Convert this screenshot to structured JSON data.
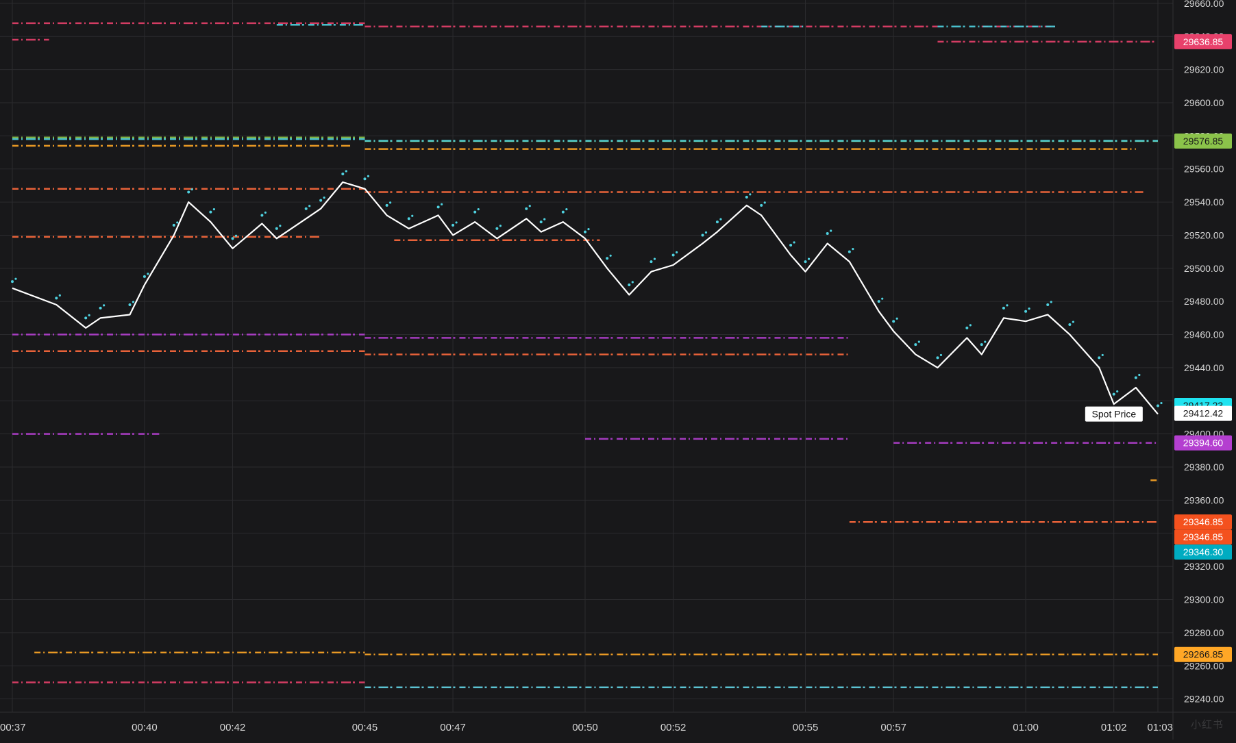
{
  "chart_data": {
    "type": "line",
    "title": "",
    "xlabel": "",
    "ylabel": "",
    "grid": true,
    "x_ticks": [
      "00:37",
      "00:40",
      "00:42",
      "00:45",
      "00:47",
      "00:50",
      "00:52",
      "00:55",
      "00:57",
      "01:00",
      "01:02",
      "01:03"
    ],
    "y_ticks": [
      29240,
      29260,
      29280,
      29300,
      29320,
      29340,
      29360,
      29380,
      29400,
      29420,
      29440,
      29460,
      29480,
      29500,
      29520,
      29540,
      29560,
      29580,
      29600,
      29620,
      29640,
      29660
    ],
    "ylim": [
      29232,
      29662
    ],
    "series": [
      {
        "name": "Spot Price",
        "color": "#ffffff",
        "style": "line",
        "x": [
          "00:37",
          "00:38",
          "00:38:40",
          "00:39",
          "00:39:40",
          "00:40",
          "00:40:40",
          "00:41",
          "00:41:30",
          "00:42",
          "00:42:40",
          "00:43",
          "00:43:40",
          "00:44",
          "00:44:30",
          "00:45",
          "00:45:30",
          "00:46",
          "00:46:40",
          "00:47",
          "00:47:30",
          "00:48",
          "00:48:40",
          "00:49",
          "00:49:30",
          "00:50",
          "00:50:30",
          "00:51",
          "00:51:30",
          "00:52",
          "00:52:40",
          "00:53",
          "00:53:40",
          "00:54",
          "00:54:40",
          "00:55",
          "00:55:30",
          "00:56",
          "00:56:40",
          "00:57",
          "00:57:30",
          "00:58",
          "00:58:40",
          "00:59",
          "00:59:30",
          "01:00",
          "01:00:30",
          "01:01",
          "01:01:40",
          "01:02",
          "01:02:30",
          "01:03"
        ],
        "y": [
          29488,
          29478,
          29464,
          29470,
          29472,
          29490,
          29520,
          29540,
          29528,
          29512,
          29527,
          29518,
          29530,
          29536,
          29552,
          29548,
          29532,
          29524,
          29532,
          29520,
          29528,
          29518,
          29530,
          29522,
          29528,
          29518,
          29500,
          29484,
          29498,
          29502,
          29515,
          29522,
          29538,
          29532,
          29508,
          29498,
          29515,
          29504,
          29474,
          29462,
          29448,
          29440,
          29458,
          29448,
          29470,
          29468,
          29472,
          29460,
          29440,
          29418,
          29428,
          29412
        ]
      },
      {
        "name": "Spot Price (tick)",
        "color": "#4fd2e0",
        "style": "dots",
        "x": [
          "00:37",
          "00:38",
          "00:38:40",
          "00:39",
          "00:39:40",
          "00:40",
          "00:40:40",
          "00:41",
          "00:41:30",
          "00:42",
          "00:42:40",
          "00:43",
          "00:43:40",
          "00:44",
          "00:44:30",
          "00:45",
          "00:45:30",
          "00:46",
          "00:46:40",
          "00:47",
          "00:47:30",
          "00:48",
          "00:48:40",
          "00:49",
          "00:49:30",
          "00:50",
          "00:50:30",
          "00:51",
          "00:51:30",
          "00:52",
          "00:52:40",
          "00:53",
          "00:53:40",
          "00:54",
          "00:54:40",
          "00:55",
          "00:55:30",
          "00:56",
          "00:56:40",
          "00:57",
          "00:57:30",
          "00:58",
          "00:58:40",
          "00:59",
          "00:59:30",
          "01:00",
          "01:00:30",
          "01:01",
          "01:01:40",
          "01:02",
          "01:02:30",
          "01:03"
        ],
        "y": [
          29492,
          29482,
          29470,
          29476,
          29478,
          29495,
          29526,
          29546,
          29534,
          29518,
          29532,
          29524,
          29536,
          29541,
          29557,
          29554,
          29538,
          29530,
          29537,
          29526,
          29534,
          29524,
          29536,
          29528,
          29534,
          29522,
          29506,
          29490,
          29504,
          29508,
          29520,
          29528,
          29543,
          29538,
          29514,
          29504,
          29521,
          29510,
          29480,
          29468,
          29454,
          29446,
          29464,
          29454,
          29476,
          29474,
          29478,
          29466,
          29446,
          29424,
          29434,
          29417
        ]
      }
    ],
    "levels": [
      {
        "color": "#e8416b",
        "segments": [
          [
            29648,
            "00:37",
            "00:45"
          ],
          [
            29646,
            "00:45",
            "00:58"
          ],
          [
            29646,
            "00:59",
            "01:00:40"
          ]
        ]
      },
      {
        "color": "#4fd2e0",
        "segments": [
          [
            29647,
            "00:43",
            "00:45"
          ],
          [
            29646,
            "00:54",
            "00:55"
          ],
          [
            29646,
            "00:58",
            "01:00:40"
          ]
        ]
      },
      {
        "color": "#e8416b",
        "segments": [
          [
            29638,
            "00:37",
            "00:37:50"
          ],
          [
            29636.85,
            "00:58",
            "01:03"
          ]
        ]
      },
      {
        "color": "#8bc34a",
        "segments": [
          [
            29579,
            "00:37",
            "00:45"
          ],
          [
            29576.85,
            "00:45",
            "01:03"
          ]
        ]
      },
      {
        "color": "#4fd2e0",
        "segments": [
          [
            29578,
            "00:37",
            "00:45"
          ],
          [
            29577,
            "00:45",
            "01:03"
          ]
        ]
      },
      {
        "color": "#ffa726",
        "segments": [
          [
            29574,
            "00:37",
            "00:44:40"
          ],
          [
            29572,
            "00:45",
            "01:02:30"
          ]
        ]
      },
      {
        "color": "#ff6b3d",
        "segments": [
          [
            29548,
            "00:37",
            "00:45"
          ],
          [
            29546,
            "00:45",
            "01:02:40"
          ]
        ]
      },
      {
        "color": "#ff6b3d",
        "segments": [
          [
            29519,
            "00:37",
            "00:44"
          ],
          [
            29517,
            "00:45:40",
            "00:50:20"
          ]
        ]
      },
      {
        "color": "#b43fd0",
        "segments": [
          [
            29460,
            "00:37",
            "00:45"
          ],
          [
            29458,
            "00:45",
            "00:56"
          ]
        ]
      },
      {
        "color": "#ff6b3d",
        "segments": [
          [
            29450,
            "00:37",
            "00:45"
          ],
          [
            29448,
            "00:45",
            "00:56"
          ]
        ]
      },
      {
        "color": "#b43fd0",
        "segments": [
          [
            29400,
            "00:37",
            "00:40:20"
          ],
          [
            29397,
            "00:50",
            "00:56"
          ],
          [
            29394.6,
            "00:57",
            "01:03"
          ]
        ]
      },
      {
        "color": "#ffa726",
        "segments": [
          [
            29372,
            "01:02:50",
            "01:03"
          ]
        ]
      },
      {
        "color": "#ff6b3d",
        "segments": [
          [
            29346.85,
            "00:56",
            "01:03"
          ]
        ]
      },
      {
        "color": "#ffa726",
        "segments": [
          [
            29268,
            "00:37:30",
            "00:45"
          ],
          [
            29266.85,
            "00:45",
            "01:03"
          ]
        ]
      },
      {
        "color": "#e8416b",
        "segments": [
          [
            29250,
            "00:37",
            "00:45"
          ],
          [
            29247,
            "00:45",
            "01:03"
          ]
        ]
      },
      {
        "color": "#4fd2e0",
        "segments": [
          [
            29247,
            "00:45",
            "01:03"
          ]
        ]
      }
    ],
    "price_labels": [
      {
        "value": 29636.85,
        "text": "29636.85",
        "bg": "#e8416b",
        "fg": "#ffffff"
      },
      {
        "value": 29576.85,
        "text": "29576.85",
        "bg": "#8bc34a",
        "fg": "#1a1a1a"
      },
      {
        "value": 29417.23,
        "text": "29417.23",
        "bg": "#1fe3f0",
        "fg": "#1a1a1a"
      },
      {
        "value": 29412.42,
        "text": "29412.42",
        "bg": "#ffffff",
        "fg": "#1a1a1a"
      },
      {
        "value": 29394.6,
        "text": "29394.60",
        "bg": "#b43fd0",
        "fg": "#ffffff"
      },
      {
        "value": 29346.85,
        "text": "29346.85",
        "bg": "#f4511e",
        "fg": "#ffffff"
      },
      {
        "value": 29346.85,
        "text": "29346.85",
        "bg": "#f4511e",
        "fg": "#ffffff",
        "stack": 1
      },
      {
        "value": 29346.3,
        "text": "29346.30",
        "bg": "#00acc1",
        "fg": "#ffffff",
        "stack": 2
      },
      {
        "value": 29266.85,
        "text": "29266.85",
        "bg": "#ffa726",
        "fg": "#1a1a1a"
      }
    ],
    "annotations": [
      {
        "text": "Spot Price",
        "x": "01:02:30",
        "y": 29412
      }
    ]
  },
  "watermark": "小红书",
  "colors": {
    "background": "#18181a",
    "grid": "#2b2b2e",
    "axis_text": "#d7d7d7"
  }
}
